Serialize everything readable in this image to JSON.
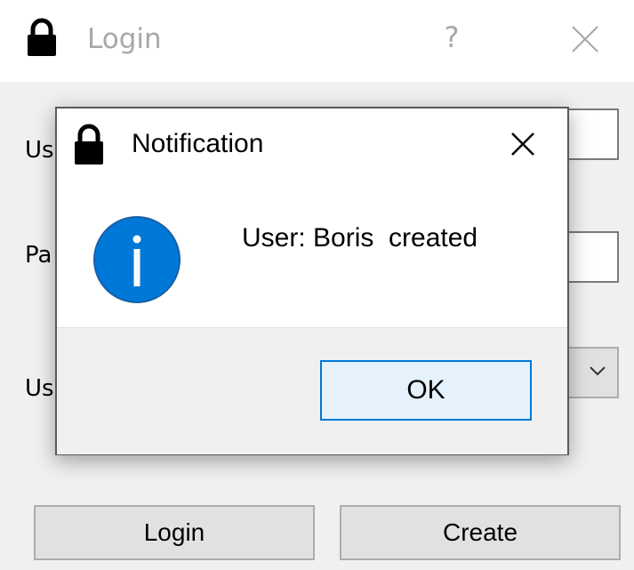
{
  "login_window": {
    "title": "Login",
    "help_label": "?",
    "labels": {
      "username_partial": "Us",
      "password_partial": "Pa",
      "usertype_partial": "Us"
    },
    "buttons": {
      "login": "Login",
      "create": "Create"
    }
  },
  "notification": {
    "title": "Notification",
    "message": "User: Boris  created",
    "ok_label": "OK"
  },
  "icons": {
    "lock": "lock-icon",
    "close": "close-icon",
    "info": "info-icon",
    "chevron": "chevron-down-icon"
  },
  "colors": {
    "info_blue": "#0078d7",
    "ok_focus_border": "#0078d7",
    "ok_background": "#e5f1fb",
    "inactive_title": "#a8a8a8"
  }
}
